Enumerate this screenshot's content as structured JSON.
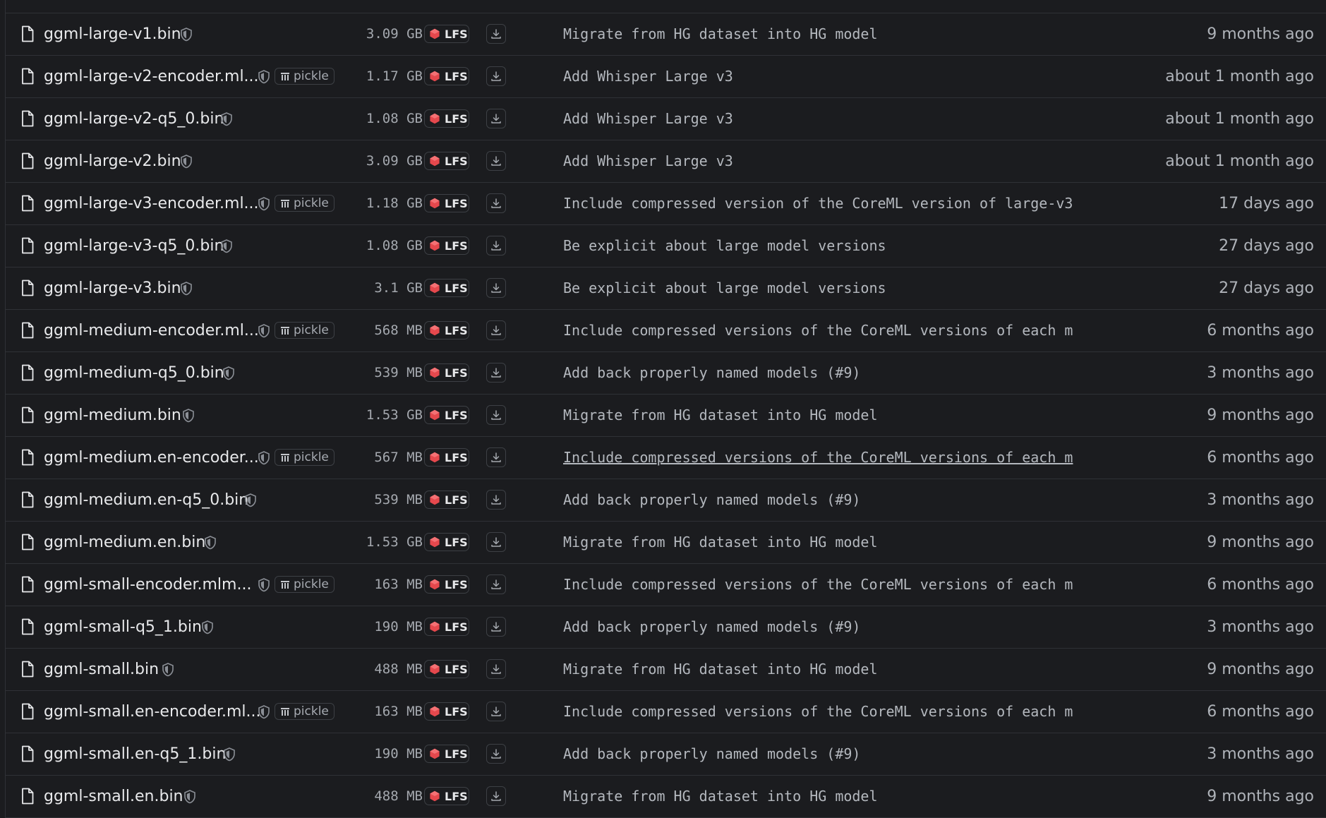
{
  "icons": {
    "file": "file-icon",
    "safe": "shield-check-icon",
    "pickle": "pickle-icon",
    "lfs": "lfs-icon",
    "download": "download-icon"
  },
  "colors": {
    "background": "#1b1c1f",
    "lfs_red": "#e5484d",
    "border": "#2f3136"
  },
  "files": [
    {
      "name": "ggml-large-v1.bin",
      "pickle": "",
      "size": "",
      "lfs": "",
      "commit": "",
      "date": ""
    },
    {
      "name": "ggml-large-v1.bin",
      "pickle": "",
      "size": "3.09 GB",
      "lfs": "LFS",
      "commit": "Migrate from HG dataset into HG model",
      "date": "9 months ago"
    },
    {
      "name": "ggml-large-v2-encoder.ml...",
      "pickle": "pickle",
      "size": "1.17 GB",
      "lfs": "LFS",
      "commit": "Add Whisper Large v3",
      "date": "about 1 month ago"
    },
    {
      "name": "ggml-large-v2-q5_0.bin",
      "pickle": "",
      "size": "1.08 GB",
      "lfs": "LFS",
      "commit": "Add Whisper Large v3",
      "date": "about 1 month ago"
    },
    {
      "name": "ggml-large-v2.bin",
      "pickle": "",
      "size": "3.09 GB",
      "lfs": "LFS",
      "commit": "Add Whisper Large v3",
      "date": "about 1 month ago"
    },
    {
      "name": "ggml-large-v3-encoder.ml...",
      "pickle": "pickle",
      "size": "1.18 GB",
      "lfs": "LFS",
      "commit": "Include compressed version of the CoreML version of large-v3",
      "date": "17 days ago"
    },
    {
      "name": "ggml-large-v3-q5_0.bin",
      "pickle": "",
      "size": "1.08 GB",
      "lfs": "LFS",
      "commit": "Be explicit about large model versions",
      "date": "27 days ago"
    },
    {
      "name": "ggml-large-v3.bin",
      "pickle": "",
      "size": "3.1 GB",
      "lfs": "LFS",
      "commit": "Be explicit about large model versions",
      "date": "27 days ago"
    },
    {
      "name": "ggml-medium-encoder.ml...",
      "pickle": "pickle",
      "size": "568 MB",
      "lfs": "LFS",
      "commit": "Include compressed versions of the CoreML versions of each m",
      "date": "6 months ago"
    },
    {
      "name": "ggml-medium-q5_0.bin",
      "pickle": "",
      "size": "539 MB",
      "lfs": "LFS",
      "commit": "Add back properly named models (#9)",
      "date": "3 months ago"
    },
    {
      "name": "ggml-medium.bin",
      "pickle": "",
      "size": "1.53 GB",
      "lfs": "LFS",
      "commit": "Migrate from HG dataset into HG model",
      "date": "9 months ago"
    },
    {
      "name": "ggml-medium.en-encoder...",
      "pickle": "pickle",
      "size": "567 MB",
      "lfs": "LFS",
      "commit": "Include compressed versions of the CoreML versions of each m",
      "date": "6 months ago",
      "hover": true
    },
    {
      "name": "ggml-medium.en-q5_0.bin",
      "pickle": "",
      "size": "539 MB",
      "lfs": "LFS",
      "commit": "Add back properly named models (#9)",
      "date": "3 months ago"
    },
    {
      "name": "ggml-medium.en.bin",
      "pickle": "",
      "size": "1.53 GB",
      "lfs": "LFS",
      "commit": "Migrate from HG dataset into HG model",
      "date": "9 months ago"
    },
    {
      "name": "ggml-small-encoder.mlm...",
      "pickle": "pickle",
      "size": "163 MB",
      "lfs": "LFS",
      "commit": "Include compressed versions of the CoreML versions of each m",
      "date": "6 months ago"
    },
    {
      "name": "ggml-small-q5_1.bin",
      "pickle": "",
      "size": "190 MB",
      "lfs": "LFS",
      "commit": "Add back properly named models (#9)",
      "date": "3 months ago"
    },
    {
      "name": "ggml-small.bin",
      "pickle": "",
      "size": "488 MB",
      "lfs": "LFS",
      "commit": "Migrate from HG dataset into HG model",
      "date": "9 months ago"
    },
    {
      "name": "ggml-small.en-encoder.ml...",
      "pickle": "pickle",
      "size": "163 MB",
      "lfs": "LFS",
      "commit": "Include compressed versions of the CoreML versions of each m",
      "date": "6 months ago"
    },
    {
      "name": "ggml-small.en-q5_1.bin",
      "pickle": "",
      "size": "190 MB",
      "lfs": "LFS",
      "commit": "Add back properly named models (#9)",
      "date": "3 months ago"
    },
    {
      "name": "ggml-small.en.bin",
      "pickle": "",
      "size": "488 MB",
      "lfs": "LFS",
      "commit": "Migrate from HG dataset into HG model",
      "date": "9 months ago"
    }
  ]
}
